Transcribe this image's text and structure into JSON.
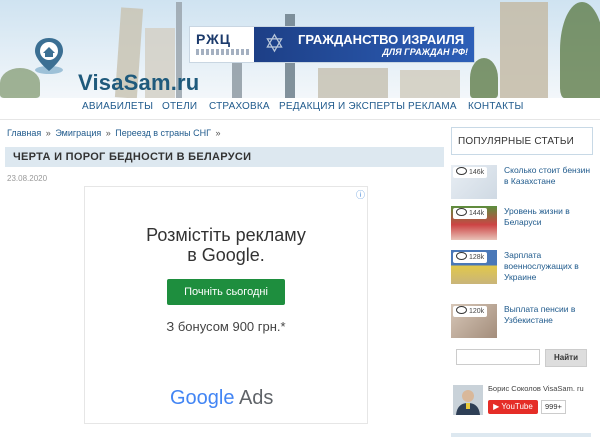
{
  "site": {
    "logo_text": "VisaSam.ru",
    "brand_color": "#1f5a7c"
  },
  "banner": {
    "logo": "РЖЦ",
    "title": "ГРАЖДАНСТВО ИЗРАИЛЯ",
    "subtitle": "ДЛЯ ГРАЖДАН РФ!",
    "icon": "star-of-david-icon"
  },
  "nav": {
    "items": [
      "АВИАБИЛЕТЫ",
      "ОТЕЛИ",
      "СТРАХОВКА",
      "РЕДАКЦИЯ И ЭКСПЕРТЫ",
      "РЕКЛАМА",
      "КОНТАКТЫ"
    ]
  },
  "breadcrumb": {
    "items": [
      "Главная",
      "Эмиграция",
      "Переезд в страны СНГ"
    ],
    "separator": "»"
  },
  "article": {
    "title": "ЧЕРТА И ПОРОГ БЕДНОСТИ В БЕЛАРУСИ",
    "date": "23.08.2020"
  },
  "ad": {
    "headline_1": "Розмістіть рекламу",
    "headline_2": "в Google.",
    "button": "Почніть сьогодні",
    "bonus": "З бонусом 900 грн.*",
    "brand_google": "Google",
    "brand_ads": "Ads",
    "info_icon": "ⓘ"
  },
  "sidebar": {
    "popular_title": "ПОПУЛЯРНЫЕ СТАТЬИ",
    "articles": [
      {
        "views": "146k",
        "title": "Сколько стоит бензин в Казахстане"
      },
      {
        "views": "144k",
        "title": "Уровень жизни в Беларуси"
      },
      {
        "views": "128k",
        "title": "Зарплата военнослужащих в Украине"
      },
      {
        "views": "120k",
        "title": "Выплата пенсии в Узбекистане"
      }
    ],
    "search_button": "Найти",
    "search_placeholder": "",
    "author": "Борис Соколов VisaSam. ru",
    "youtube_label": "YouTube",
    "youtube_count": "999+"
  }
}
